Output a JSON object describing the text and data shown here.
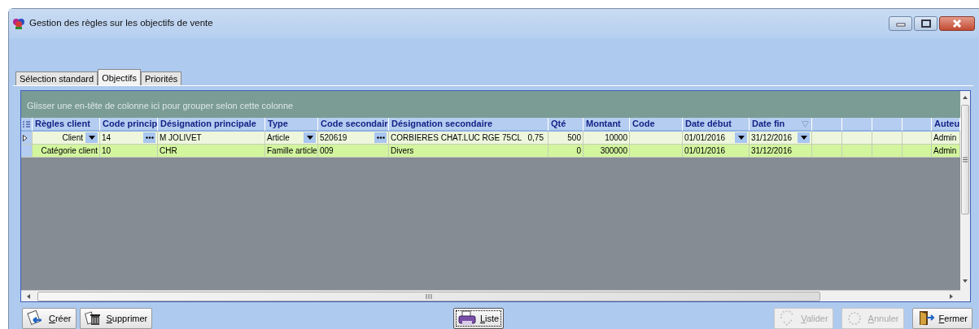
{
  "window": {
    "title": "Gestion des règles sur les objectifs de vente"
  },
  "tabs": [
    {
      "label": "Sélection standard",
      "selected": false
    },
    {
      "label": "Objectifs",
      "selected": true
    },
    {
      "label": "Priorités",
      "selected": false
    }
  ],
  "grid": {
    "group_hint": "Glisser une en-tête de colonne ici pour grouper selon cette colonne",
    "columns": [
      {
        "label": "Règles client"
      },
      {
        "label": "Code princip"
      },
      {
        "label": "Désignation principale"
      },
      {
        "label": "Type"
      },
      {
        "label": "Code secondair"
      },
      {
        "label": "Désignation secondaire"
      },
      {
        "label": "Qté"
      },
      {
        "label": "Montant"
      },
      {
        "label": "Code"
      },
      {
        "label": "Date début"
      },
      {
        "label": "Date fin",
        "filter": true
      },
      {
        "kind": "blank"
      },
      {
        "kind": "blank"
      },
      {
        "kind": "blank"
      },
      {
        "kind": "blank"
      },
      {
        "label": "Auteu"
      }
    ],
    "rows": [
      {
        "current": true,
        "cells": [
          {
            "text": "Client"
          },
          {
            "text": "14"
          },
          {
            "text": "M JOLIVET"
          },
          {
            "text": "Article"
          },
          {
            "text": "520619"
          },
          {
            "text": "CORBIERES CHAT.LUC RGE 75CL",
            "suffix": "0,75"
          },
          {
            "text": "500"
          },
          {
            "text": "10000"
          },
          {},
          {
            "text": "01/01/2016"
          },
          {
            "text": "31/12/2016"
          },
          {
            "text": "Admin"
          }
        ]
      },
      {
        "current": false,
        "cells": [
          {
            "text": "Catégorie client"
          },
          {
            "text": "10"
          },
          {
            "text": "CHR"
          },
          {
            "text": "Famille article"
          },
          {
            "text": "009"
          },
          {
            "text": "Divers"
          },
          {
            "text": "0"
          },
          {
            "text": "300000"
          },
          {},
          {
            "text": "01/01/2016"
          },
          {
            "text": "31/12/2016"
          },
          {
            "text": "Admin"
          }
        ]
      }
    ]
  },
  "buttons": [
    {
      "label": "Créer",
      "disabled": false,
      "focused": false
    },
    {
      "label": "Supprimer",
      "disabled": false,
      "focused": false
    },
    {
      "label": "Liste",
      "disabled": false,
      "focused": true
    },
    {
      "label": "Valider",
      "disabled": true,
      "focused": false
    },
    {
      "label": "Annuler",
      "disabled": true,
      "focused": false
    },
    {
      "label": "Fermer",
      "disabled": false,
      "focused": false
    }
  ]
}
